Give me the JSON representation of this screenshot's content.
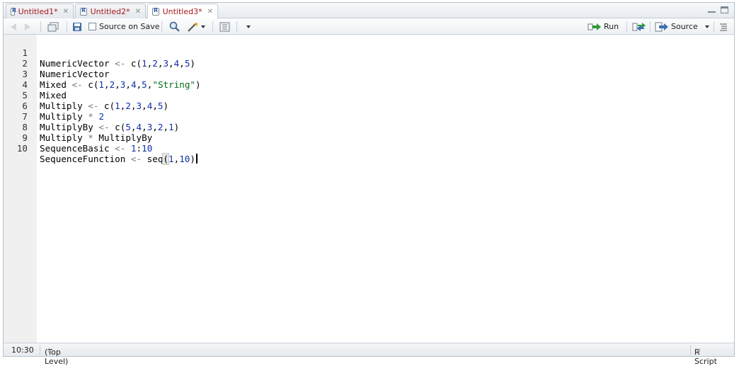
{
  "tabs": [
    {
      "label": "Untitled1*",
      "active": false
    },
    {
      "label": "Untitled2*",
      "active": false
    },
    {
      "label": "Untitled3*",
      "active": true
    }
  ],
  "toolbar": {
    "source_on_save_label": "Source on Save",
    "source_on_save_checked": false,
    "run_label": "Run",
    "source_label": "Source"
  },
  "editor": {
    "lines": [
      {
        "n": "1",
        "text": "NumericVector <- c(1,2,3,4,5)"
      },
      {
        "n": "2",
        "text": "NumericVector"
      },
      {
        "n": "3",
        "text": "Mixed <- c(1,2,3,4,5,\"String\")"
      },
      {
        "n": "4",
        "text": "Mixed"
      },
      {
        "n": "5",
        "text": "Multiply <- c(1,2,3,4,5)"
      },
      {
        "n": "6",
        "text": "Multiply * 2"
      },
      {
        "n": "7",
        "text": "MultiplyBy <- c(5,4,3,2,1)"
      },
      {
        "n": "8",
        "text": "Multiply * MultiplyBy"
      },
      {
        "n": "9",
        "text": "SequenceBasic <- 1:10"
      },
      {
        "n": "10",
        "text": "SequenceFunction <- seq(1,10)"
      }
    ]
  },
  "status": {
    "cursor_position": "10:30",
    "scope": "(Top Level)",
    "file_type": "R Script"
  },
  "colors": {
    "tab_text": "#a8171a",
    "number": "#0d2fa8",
    "string": "#046b1a",
    "operator": "#7a7a7a",
    "gutter": "#f0f0f0"
  },
  "icons": [
    "r-file-icon",
    "close-icon",
    "back-arrow-icon",
    "forward-arrow-icon",
    "show-in-window-icon",
    "save-icon",
    "find-icon",
    "code-tools-wand-icon",
    "compile-notebook-icon",
    "run-arrow-icon",
    "rerun-icon",
    "source-icon",
    "outline-icon",
    "minimize-icon",
    "maximize-icon"
  ]
}
